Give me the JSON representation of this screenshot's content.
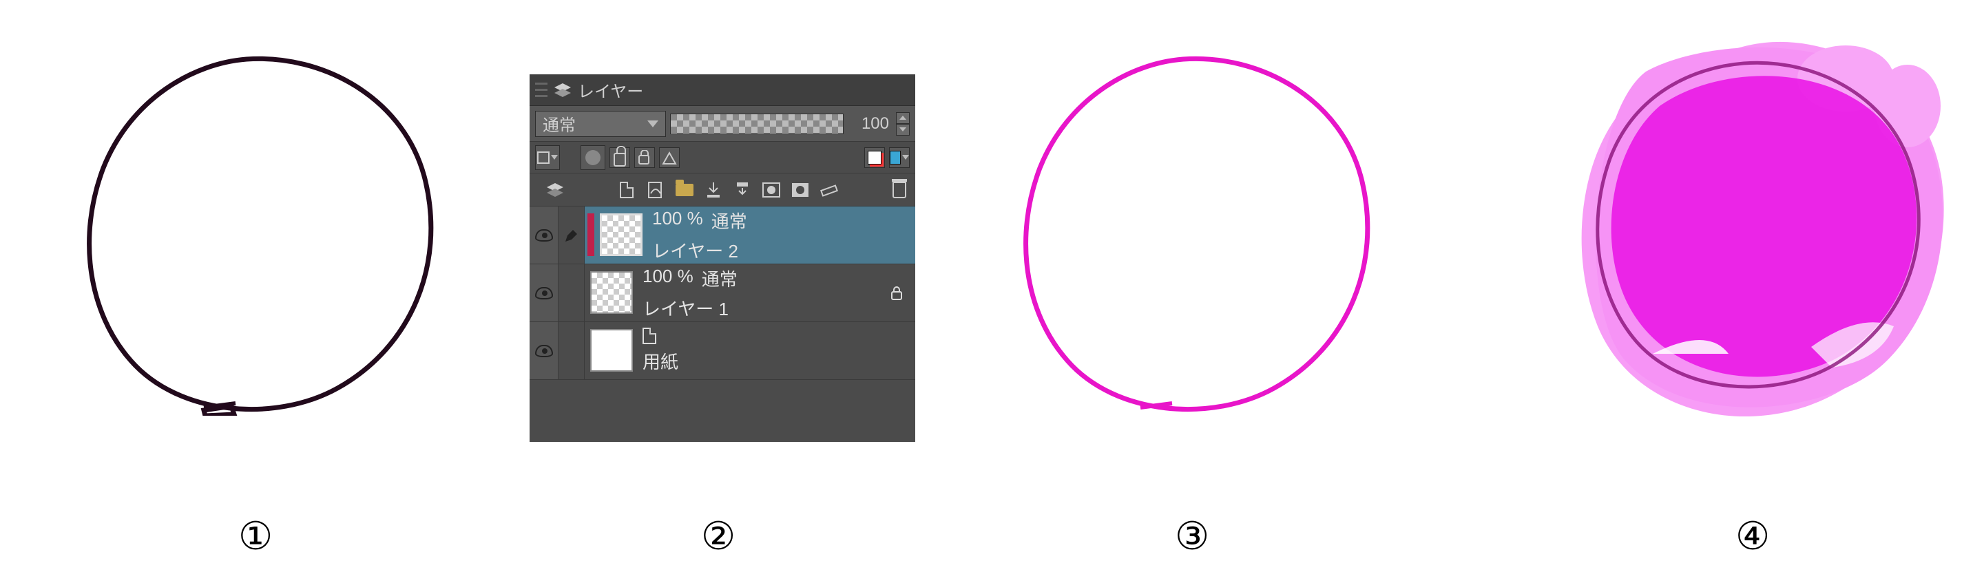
{
  "labels": {
    "step1": "①",
    "step2": "②",
    "step3": "③",
    "step4": "④"
  },
  "panel": {
    "title": "レイヤー",
    "blend_mode": "通常",
    "opacity": "100",
    "layers": [
      {
        "opacity": "100 %",
        "mode": "通常",
        "name": "レイヤー 2"
      },
      {
        "opacity": "100 %",
        "mode": "通常",
        "name": "レイヤー 1"
      },
      {
        "name": "用紙"
      }
    ]
  },
  "colors": {
    "line_dark": "#2a0f22",
    "line_magenta": "#e815c9",
    "fill_magenta": "#eb1ae7",
    "fill_magenta_light": "#f46ef1"
  }
}
